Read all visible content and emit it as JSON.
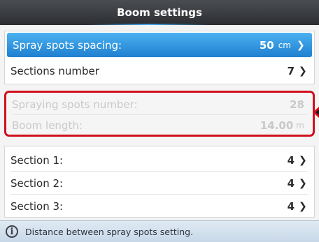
{
  "header": {
    "title": "Boom settings"
  },
  "settings_group_1": [
    {
      "label": "Spray spots spacing:",
      "value": "50",
      "unit": "cm",
      "selected": true
    },
    {
      "label": "Sections number",
      "value": "7",
      "unit": ""
    }
  ],
  "computed_group": [
    {
      "label": "Spraying spots number:",
      "value": "28",
      "unit": ""
    },
    {
      "label": "Boom length:",
      "value": "14.00",
      "unit": "m"
    }
  ],
  "sections_group": [
    {
      "label": "Section 1:",
      "value": "4"
    },
    {
      "label": "Section 2:",
      "value": "4"
    },
    {
      "label": "Section 3:",
      "value": "4"
    }
  ],
  "info_bar": {
    "text": "Distance between spray spots setting."
  },
  "colors": {
    "selection": "#2a90e0",
    "highlight_border": "#d0101e",
    "header_bg": "#2f3136"
  },
  "icons": {
    "chevron": "chevron-right-icon",
    "info": "info-icon"
  }
}
